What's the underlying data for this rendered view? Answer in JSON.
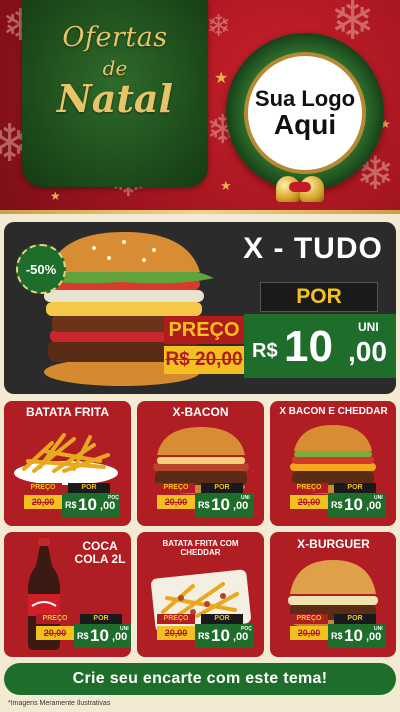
{
  "header": {
    "title_line1": "Ofertas",
    "title_line2": "de",
    "title_line3": "Natal",
    "logo_line1": "Sua Logo",
    "logo_line2": "Aqui"
  },
  "featured": {
    "name": "X - TUDO",
    "discount": "-50%",
    "por_label": "POR",
    "preco_label": "PREÇO",
    "old_price": "R$ 20,00",
    "currency": "R$",
    "new_price_int": "10",
    "new_price_dec": ",00",
    "unit": "UNI"
  },
  "products": [
    {
      "name": "BATATA FRITA",
      "preco_label": "PREÇO",
      "old_price": "20,00",
      "por_label": "POR",
      "currency": "R$",
      "price_int": "10",
      "price_dec": ",00",
      "unit": "POÇ"
    },
    {
      "name": "X-BACON",
      "preco_label": "PREÇO",
      "old_price": "20,00",
      "por_label": "POR",
      "currency": "R$",
      "price_int": "10",
      "price_dec": ",00",
      "unit": "UNI"
    },
    {
      "name": "X BACON E CHEDDAR",
      "preco_label": "PREÇO",
      "old_price": "20,00",
      "por_label": "POR",
      "currency": "R$",
      "price_int": "10",
      "price_dec": ",00",
      "unit": "UNI"
    },
    {
      "name": "COCA COLA 2L",
      "preco_label": "PREÇO",
      "old_price": "20,00",
      "por_label": "POR",
      "currency": "R$",
      "price_int": "10",
      "price_dec": ",00",
      "unit": "UNI"
    },
    {
      "name": "BATATA FRITA COM CHEDDAR",
      "preco_label": "PREÇO",
      "old_price": "20,00",
      "por_label": "POR",
      "currency": "R$",
      "price_int": "10",
      "price_dec": ",00",
      "unit": "POÇ"
    },
    {
      "name": "X-BURGUER",
      "preco_label": "PREÇO",
      "old_price": "20,00",
      "por_label": "POR",
      "currency": "R$",
      "price_int": "10",
      "price_dec": ",00",
      "unit": "UNI"
    }
  ],
  "cta": "Crie seu encarte com este tema!",
  "disclaimer": "*Imagens Meramente Ilustrativas",
  "colors": {
    "red": "#b01d22",
    "green": "#1f6d2a",
    "yellow": "#f2c021",
    "gold": "#c9a04a",
    "dark": "#2b2b2b"
  }
}
